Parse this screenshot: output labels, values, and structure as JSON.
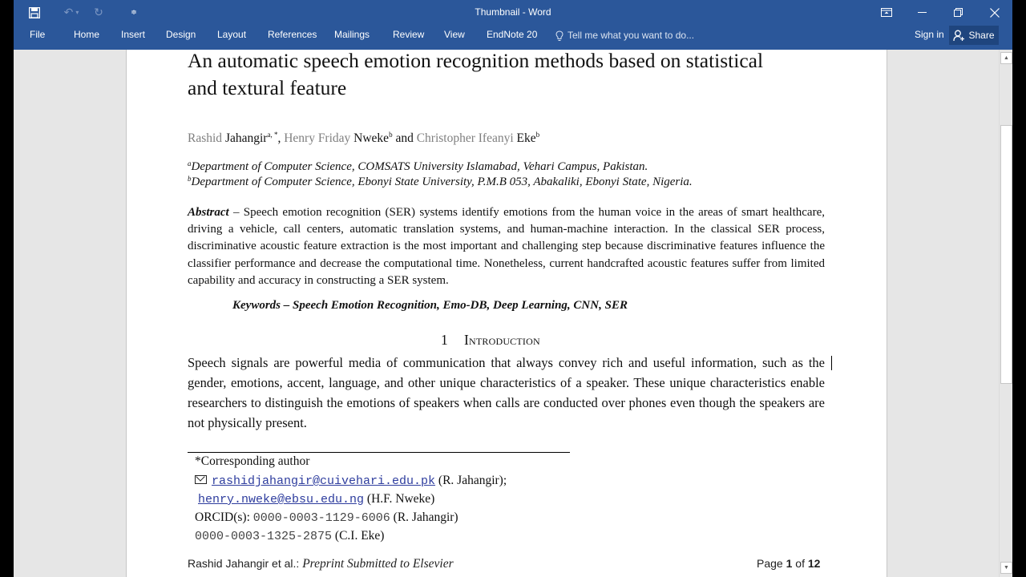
{
  "window": {
    "title": "Thumbnail - Word"
  },
  "quick_access": {
    "save_icon": "save-icon",
    "undo_icon": "undo-icon",
    "redo_icon": "redo-icon",
    "customize_icon": "customize-qat-icon"
  },
  "window_controls": {
    "ribbon_display": "ribbon-display-options-icon",
    "minimize": "minimize-icon",
    "restore": "restore-icon",
    "close": "close-icon"
  },
  "ribbon_tabs": [
    {
      "label": "File"
    },
    {
      "label": "Home"
    },
    {
      "label": "Insert"
    },
    {
      "label": "Design"
    },
    {
      "label": "Layout"
    },
    {
      "label": "References"
    },
    {
      "label": "Mailings"
    },
    {
      "label": "Review"
    },
    {
      "label": "View"
    },
    {
      "label": "EndNote 20"
    }
  ],
  "tell_me": {
    "placeholder": "Tell me what you want to do..."
  },
  "account": {
    "sign_in": "Sign in",
    "share": "Share"
  },
  "document": {
    "title_line1": "An automatic speech emotion recognition methods based on statistical",
    "title_line2": "and textural feature",
    "authors": [
      {
        "given": "Rashid",
        "family": "Jahangir",
        "sup": "a, *",
        "sep": ", "
      },
      {
        "given": "Henry Friday",
        "family": "Nweke",
        "sup": "b",
        "sep": " and "
      },
      {
        "given": "Christopher Ifeanyi",
        "family": "Eke",
        "sup": "b",
        "sep": ""
      }
    ],
    "affiliations": [
      {
        "mark": "a",
        "text": "Department of Computer Science, COMSATS University Islamabad, Vehari Campus, Pakistan."
      },
      {
        "mark": "b",
        "text": "Department of Computer Science, Ebonyi State University, P.M.B 053, Abakaliki, Ebonyi State, Nigeria."
      }
    ],
    "abstract_label": "Abstract",
    "abstract_text": " – Speech emotion recognition (SER) systems identify emotions from the human voice in the areas of smart healthcare, driving a vehicle, call centers, automatic translation systems, and human-machine interaction. In the classical SER process, discriminative acoustic feature extraction is the most important and challenging step because discriminative features influence the classifier performance and decrease the computational time. Nonetheless, current handcrafted acoustic features suffer from limited capability and accuracy in constructing a SER system.",
    "keywords": "Keywords – Speech Emotion Recognition, Emo-DB, Deep Learning, CNN, SER",
    "section_number": "1",
    "section_title": "Introduction",
    "intro_text": "Speech signals are powerful media of communication that always convey rich and useful information, such as the gender, emotions, accent, language, and other unique characteristics of a speaker. These unique characteristics enable researchers to distinguish the emotions of speakers when calls are conducted over phones even though the speakers are not physically present.",
    "footnote": {
      "corresponding": "*Corresponding author",
      "email1": "rashidjahangir@cuivehari.edu.pk",
      "email1_owner": " (R. Jahangir);",
      "email2": "henry.nweke@ebsu.edu.ng",
      "email2_owner": " (H.F. Nweke)",
      "orcid_label": "ORCID(s): ",
      "orcid1": "0000-0003-1129-6006",
      "orcid1_owner": " (R. Jahangir)",
      "orcid2": "0000-0003-1325-2875",
      "orcid2_owner": " (C.I. Eke)"
    },
    "footer_left_name": "Rashid Jahangir et al.: ",
    "footer_left_italic": "Preprint Submitted to Elsevier",
    "footer_page_prefix": "Page ",
    "footer_page_current": "1",
    "footer_page_of": " of ",
    "footer_page_total": "12"
  },
  "scrollbar": {
    "position_fraction": 0.12,
    "visible_fraction": 0.52
  }
}
